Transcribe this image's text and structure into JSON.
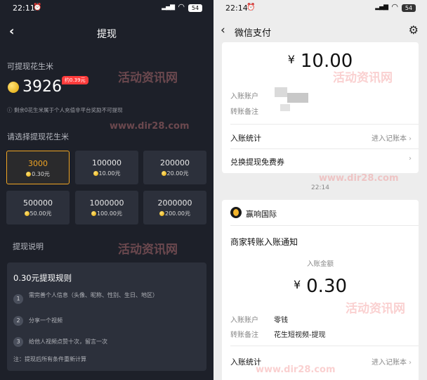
{
  "left": {
    "status": {
      "time": "22:11",
      "battery": "54"
    },
    "title": "提现",
    "available_label": "可提现花生米",
    "amount": "3926",
    "badge": "约0.39元",
    "note": "剩余0花生米属于个人充值非平台奖励不可提现",
    "choose_label": "请选择提现花生米",
    "options": [
      {
        "value": "3000",
        "price": "0.30元",
        "selected": true
      },
      {
        "value": "100000",
        "price": "10.00元"
      },
      {
        "value": "200000",
        "price": "20.00元"
      },
      {
        "value": "500000",
        "price": "50.00元"
      },
      {
        "value": "1000000",
        "price": "100.00元"
      },
      {
        "value": "2000000",
        "price": "200.00元"
      }
    ],
    "explain_label": "提现说明",
    "rules": {
      "title": "0.30元提现规则",
      "items": [
        {
          "num": "1",
          "text": "需完善个人信息（头像、昵称、性别、生日、地区）"
        },
        {
          "num": "2",
          "text": "分享一个视频"
        },
        {
          "num": "3",
          "text": "给他人视频点赞十次，留言一次"
        }
      ],
      "footnote": "注：提现后所有条件重新计算"
    }
  },
  "right": {
    "status": {
      "time": "22:14",
      "battery": "54"
    },
    "title": "微信支付",
    "card1": {
      "amount_symbol": "¥",
      "amount": "10.00",
      "account_label": "入账账户",
      "remark_label": "转账备注",
      "stats_label": "入账统计",
      "stats_link": "进入记账本",
      "coupon_label": "兑换提现免费券"
    },
    "time_sep": "22:14",
    "card2": {
      "merchant": "赢响国际",
      "title": "商家转账入账通知",
      "amount_label": "入账金额",
      "amount_symbol": "¥",
      "amount": "0.30",
      "account_label": "入账账户",
      "account_value": "零钱",
      "remark_label": "转账备注",
      "remark_value": "花生短视频-提现",
      "stats_label": "入账统计",
      "stats_link": "进入记账本"
    }
  },
  "watermark": {
    "cn": "活动资讯网",
    "url": "www.dir28.com"
  }
}
